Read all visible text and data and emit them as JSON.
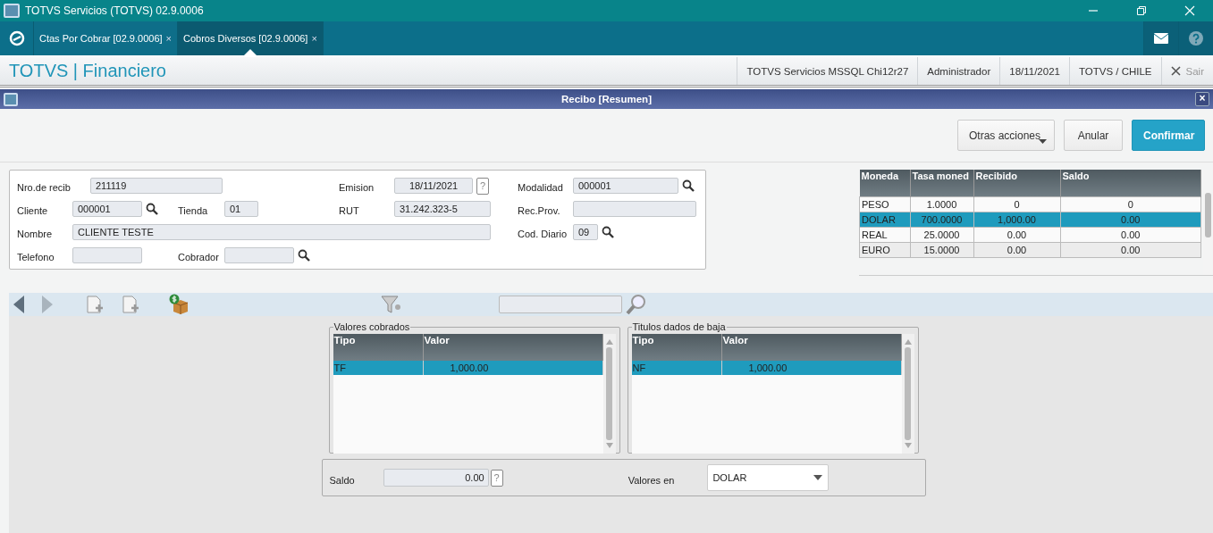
{
  "window": {
    "title": "TOTVS Servicios (TOTVS) 02.9.0006"
  },
  "tabs": [
    {
      "label": "Ctas Por Cobrar [02.9.0006]",
      "close": "×",
      "selected": false
    },
    {
      "label": "Cobros Diversos [02.9.0006]",
      "close": "×",
      "selected": true
    }
  ],
  "header": {
    "title": "TOTVS | Financiero",
    "info": [
      "TOTVS Servicios MSSQL Chi12r27",
      "Administrador",
      "18/11/2021",
      "TOTVS / CHILE"
    ],
    "exit": "Sair"
  },
  "dialog": {
    "title": "Recibo [Resumen]",
    "close": "×",
    "buttons": [
      {
        "label": "Otras acciones",
        "kind": "menu"
      },
      {
        "label": "Anular",
        "kind": "plain"
      },
      {
        "label": "Confirmar",
        "kind": "primary"
      }
    ]
  },
  "form": [
    {
      "label": "Nro.de recib",
      "value": "211119",
      "kind": "text"
    },
    {
      "label": "Emision",
      "value": "18/11/2021",
      "kind": "help",
      "help": "?"
    },
    {
      "label": "Modalidad",
      "value": "000001",
      "kind": "lookup"
    },
    {
      "label": "Cliente",
      "value": "000001",
      "kind": "lookup"
    },
    {
      "label": "Tienda",
      "value": "01",
      "kind": "text"
    },
    {
      "label": "RUT",
      "value": "31.242.323-5",
      "kind": "text"
    },
    {
      "label": "Rec.Prov.",
      "kind": "text"
    },
    {
      "label": "Nombre",
      "value": "CLIENTE TESTE",
      "kind": "text"
    },
    {
      "label": "Cod. Diario",
      "value": "09",
      "kind": "lookup"
    },
    {
      "label": "Telefono",
      "kind": "text"
    },
    {
      "label": "Cobrador",
      "kind": "lookup"
    }
  ],
  "currency_table": {
    "columns": [
      "Moneda",
      "Tasa moned",
      "Recibido",
      "Saldo"
    ],
    "rows": [
      {
        "cells": [
          "PESO",
          "1.0000",
          "0",
          "0"
        ],
        "selected": false
      },
      {
        "cells": [
          "DOLAR",
          "700.0000",
          "1,000.00",
          "0.00"
        ],
        "selected": true
      },
      {
        "cells": [
          "REAL",
          "25.0000",
          "0.00",
          "0.00"
        ],
        "selected": false
      },
      {
        "cells": [
          "EURO",
          "15.0000",
          "0.00",
          "0.00"
        ],
        "selected": false
      }
    ]
  },
  "panels": [
    {
      "title": "Valores cobrados",
      "columns": [
        "Tipo",
        "Valor"
      ],
      "rows": [
        {
          "cells": [
            "TF",
            "1,000.00"
          ],
          "selected": true
        }
      ]
    },
    {
      "title": "Titulos dados de baja",
      "columns": [
        "Tipo",
        "Valor"
      ],
      "rows": [
        {
          "cells": [
            "NF",
            "1,000.00"
          ],
          "selected": true
        }
      ]
    }
  ],
  "footer": {
    "saldo_label": "Saldo",
    "saldo": "0.00",
    "help": "?",
    "valores_label": "Valores en",
    "valores": "DOLAR"
  }
}
